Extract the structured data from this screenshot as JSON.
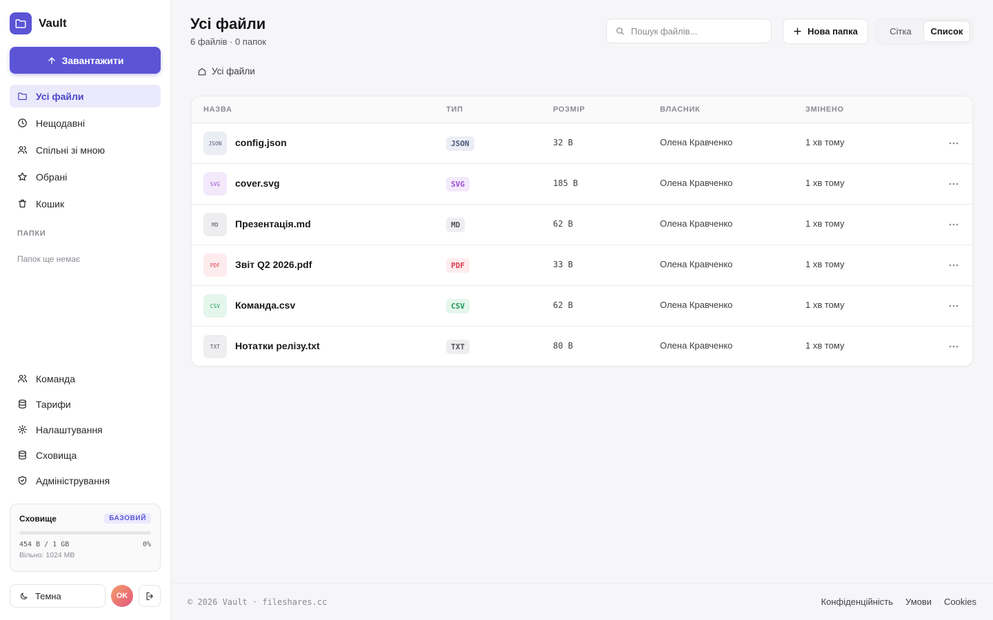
{
  "brand": {
    "name": "Vault"
  },
  "sidebar": {
    "upload_label": "Завантажити",
    "nav": [
      {
        "label": "Усі файли",
        "icon": "folder-icon",
        "active": true
      },
      {
        "label": "Нещодавні",
        "icon": "clock-icon",
        "active": false
      },
      {
        "label": "Спільні зі мною",
        "icon": "users-icon",
        "active": false
      },
      {
        "label": "Обрані",
        "icon": "star-icon",
        "active": false
      },
      {
        "label": "Кошик",
        "icon": "trash-icon",
        "active": false
      }
    ],
    "folders_label": "ПАПКИ",
    "folders_empty": "Папок ще немає",
    "bottom_nav": [
      {
        "label": "Команда",
        "icon": "users-icon"
      },
      {
        "label": "Тарифи",
        "icon": "database-icon"
      },
      {
        "label": "Налаштування",
        "icon": "gear-icon"
      },
      {
        "label": "Сховища",
        "icon": "database-icon"
      },
      {
        "label": "Адміністрування",
        "icon": "shield-icon"
      }
    ],
    "storage": {
      "title": "Сховище",
      "plan": "БАЗОВИЙ",
      "used": "454 B / 1 GB",
      "percent": "0%",
      "fill_fraction": 0,
      "free": "Вільно: 1024 MB"
    },
    "theme_label": "Темна",
    "avatar_initials": "OK"
  },
  "header": {
    "title": "Усі файли",
    "subtitle": "6 файлів · 0 папок",
    "search_placeholder": "Пошук файлів...",
    "new_folder_label": "Нова папка",
    "view_grid": "Сітка",
    "view_list": "Список",
    "active_view": "list"
  },
  "breadcrumb": {
    "label": "Усі файли"
  },
  "table": {
    "columns": {
      "name": "НАЗВА",
      "type": "ТИП",
      "size": "РОЗМІР",
      "owner": "ВЛАСНИК",
      "modified": "ЗМІНЕНО"
    },
    "rows": [
      {
        "icon_text": "JSON",
        "name": "config.json",
        "type": "JSON",
        "size": "32 B",
        "owner": "Олена Кравченко",
        "modified": "1 хв тому",
        "tone": "json"
      },
      {
        "icon_text": "SVG",
        "name": "cover.svg",
        "type": "SVG",
        "size": "185 B",
        "owner": "Олена Кравченко",
        "modified": "1 хв тому",
        "tone": "svg"
      },
      {
        "icon_text": "MD",
        "name": "Презентація.md",
        "type": "MD",
        "size": "62 B",
        "owner": "Олена Кравченко",
        "modified": "1 хв тому",
        "tone": "md"
      },
      {
        "icon_text": "PDF",
        "name": "Звіт Q2 2026.pdf",
        "type": "PDF",
        "size": "33 B",
        "owner": "Олена Кравченко",
        "modified": "1 хв тому",
        "tone": "pdf"
      },
      {
        "icon_text": "CSV",
        "name": "Команда.csv",
        "type": "CSV",
        "size": "62 B",
        "owner": "Олена Кравченко",
        "modified": "1 хв тому",
        "tone": "csv"
      },
      {
        "icon_text": "TXT",
        "name": "Нотатки релізу.txt",
        "type": "TXT",
        "size": "80 B",
        "owner": "Олена Кравченко",
        "modified": "1 хв тому",
        "tone": "txt"
      }
    ]
  },
  "tones": {
    "json": {
      "bg": "#eceef5",
      "fg": "#4b5577"
    },
    "svg": {
      "bg": "#f3e9fb",
      "fg": "#9b4fd1"
    },
    "md": {
      "bg": "#eeeef0",
      "fg": "#52525b"
    },
    "pdf": {
      "bg": "#fdecee",
      "fg": "#dc3b4b"
    },
    "csv": {
      "bg": "#e5f6ec",
      "fg": "#1f9a55"
    },
    "txt": {
      "bg": "#eeeef0",
      "fg": "#52525b"
    }
  },
  "footer": {
    "copyright": "© 2026 Vault · fileshares.cc",
    "links": [
      "Конфіденційність",
      "Умови",
      "Cookies"
    ]
  },
  "colors": {
    "accent": "#5b55d6",
    "accent_soft": "#ebeafd"
  }
}
